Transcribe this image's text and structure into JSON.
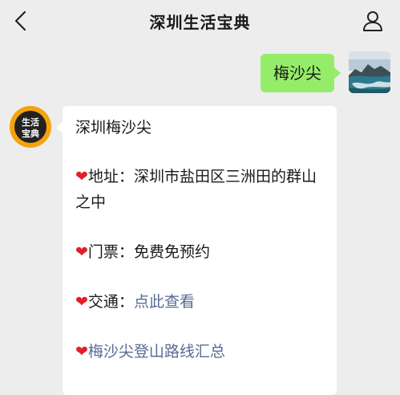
{
  "header": {
    "title": "深圳生活宝典",
    "back_icon": "chevron-left-icon",
    "profile_icon": "person-icon"
  },
  "sent_message": {
    "text": "梅沙尖"
  },
  "bot": {
    "avatar_text_line1": "生活",
    "avatar_text_line2": "宝典"
  },
  "reply": {
    "title": "深圳梅沙尖",
    "heart": "❤",
    "address_label": "地址：",
    "address_value": "深圳市盐田区三洲田的群山之中",
    "ticket_label": "门票：",
    "ticket_value": "免费免预约",
    "traffic_label": "交通：",
    "traffic_link": "点此查看",
    "route_link": "梅沙尖登山路线汇总"
  },
  "colors": {
    "background": "#ededed",
    "sent_bubble": "#95ec69",
    "link": "#576b95",
    "heart": "#e0202a",
    "avatar_bg": "#f5a30d"
  }
}
